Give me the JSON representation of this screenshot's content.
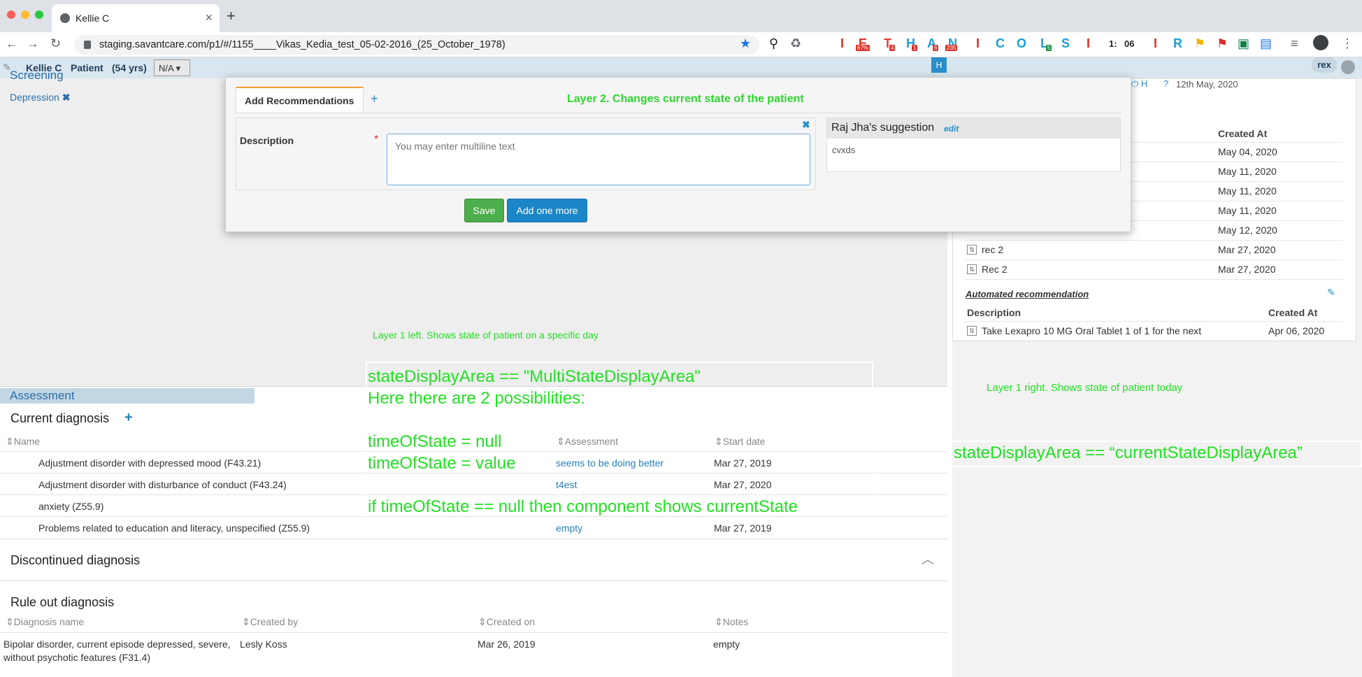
{
  "browser": {
    "tab_title": "Kellie C",
    "url": "staging.savantcare.com/p1/#/1155____Vikas_Kedia_test_05-02-2016_(25_October_1978)",
    "ext_labels": [
      "E",
      "T",
      "H",
      "A",
      "N",
      "C",
      "O",
      "L",
      "S",
      "R"
    ],
    "badges": [
      "67%",
      "4",
      "1",
      "6",
      "235",
      "5"
    ],
    "clock": "1:",
    "clock2": "06"
  },
  "header": {
    "patient_name": "Kellie C",
    "patient_label": "Patient",
    "patient_age": "(54 yrs)",
    "na_select": "N/A",
    "h_button": "H",
    "user": "rex"
  },
  "screening": {
    "title": "Screening",
    "item": "Depression"
  },
  "modal": {
    "tab_label": "Add Recommendations",
    "annotation": "Layer 2. Changes current state of the patient",
    "description_label": "Description",
    "placeholder": "You may enter multiline text",
    "save_label": "Save",
    "add_more_label": "Add one more",
    "suggestion_title": "Raj Jha's suggestion",
    "suggestion_edit": "edit",
    "suggestion_text": "cvxds"
  },
  "annotations": {
    "layer1_left": "Layer 1 left. Shows state of patient on a specific day",
    "layer1_right": "Layer 1 right. Shows state of patient today",
    "multi_lines": [
      "stateDisplayArea == \"MultiStateDisplayArea\"",
      "Here there are 2 possibilities:",
      "",
      "timeOfState = null",
      "timeOfState = value",
      "",
      "if timeOfState == null then component shows currentState"
    ],
    "current_state": "stateDisplayArea == “currentStateDisplayArea”"
  },
  "right_panel": {
    "date": "12th May, 2020",
    "col_created": "Created At",
    "rows": [
      {
        "desc": "",
        "date": "May 04, 2020"
      },
      {
        "desc": "",
        "date": "May 11, 2020"
      },
      {
        "desc": "",
        "date": "May 11, 2020"
      },
      {
        "desc": "",
        "date": "May 11, 2020"
      },
      {
        "desc": "",
        "date": "May 12, 2020"
      },
      {
        "desc": "rec 2",
        "date": "Mar 27, 2020"
      },
      {
        "desc": "Rec 2",
        "date": "Mar 27, 2020"
      }
    ],
    "auto_title": "Automated recommendation",
    "auto_col_desc": "Description",
    "auto_col_created": "Created At",
    "auto_rows": [
      {
        "desc": "Take Lexapro 10 MG Oral Tablet 1 of 1 for the next",
        "date": "Apr 06, 2020"
      }
    ]
  },
  "assessment": {
    "title": "Assessment",
    "current_title": "Current diagnosis",
    "col_name": "Name",
    "col_assessment": "Assessment",
    "col_start": "Start date",
    "rows": [
      {
        "name": "Adjustment disorder with depressed mood (F43.21)",
        "assessment": "seems to be doing better",
        "start": "Mar 27, 2019"
      },
      {
        "name": "Adjustment disorder with disturbance of conduct (F43.24)",
        "assessment": "t4est",
        "start": "Mar 27, 2020"
      },
      {
        "name": "anxiety (Z55.9)",
        "assessment": "",
        "start": ""
      },
      {
        "name": "Problems related to education and literacy, unspecified (Z55.9)",
        "assessment": "empty",
        "start": "Mar 27, 2019"
      }
    ],
    "discontinued_title": "Discontinued diagnosis",
    "ruleout_title": "Rule out diagnosis",
    "ro_col_name": "Diagnosis name",
    "ro_col_by": "Created by",
    "ro_col_on": "Created on",
    "ro_col_notes": "Notes",
    "ro_rows": [
      {
        "name_line1": "Bipolar disorder, current episode depressed, severe,",
        "name_line2": "without psychotic features (F31.4)",
        "by": "Lesly Koss",
        "on": "Mar 26, 2019",
        "notes": "empty"
      }
    ]
  }
}
